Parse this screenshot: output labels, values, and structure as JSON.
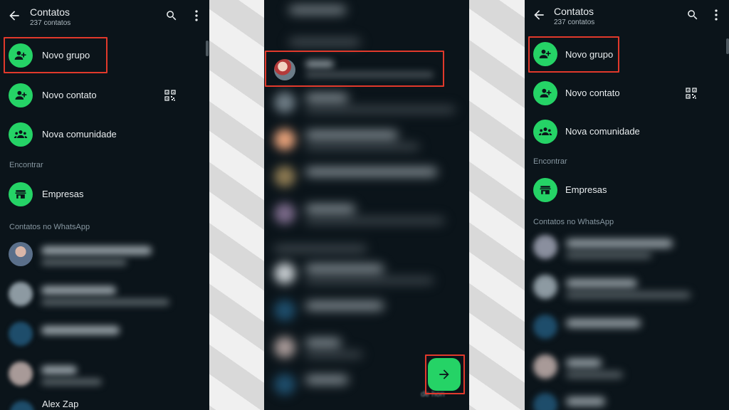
{
  "header": {
    "title": "Contatos",
    "subtitle": "237 contatos",
    "back_icon": "arrow-left-icon",
    "search_icon": "search-icon",
    "menu_icon": "more-vert-icon"
  },
  "actions": {
    "new_group": "Novo grupo",
    "new_contact": "Novo contato",
    "new_community": "Nova comunidade"
  },
  "sections": {
    "find": "Encontrar",
    "businesses": "Empresas",
    "contacts_on_whatsapp": "Contatos no WhatsApp"
  },
  "contacts": {
    "visible_name": "Alex Zap"
  },
  "middle": {
    "next_icon": "arrow-right-icon",
    "fab_caption": "de hon"
  },
  "colors": {
    "panel_bg": "#0b141a",
    "accent_green": "#25d366",
    "highlight_red": "#e1392b",
    "text_primary": "#e9edef",
    "text_secondary": "#8696a0"
  }
}
